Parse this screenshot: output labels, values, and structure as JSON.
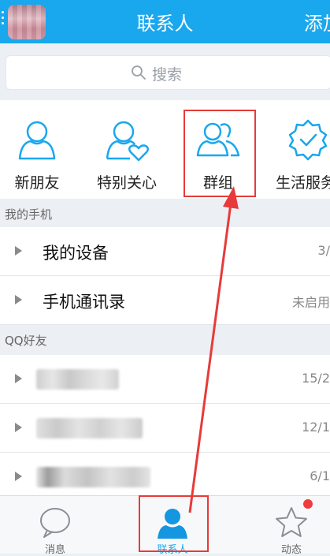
{
  "header": {
    "title": "联系人",
    "add_label": "添加"
  },
  "search": {
    "placeholder": "搜索"
  },
  "shortcuts": [
    {
      "label": "新朋友",
      "icon": "person-icon"
    },
    {
      "label": "特别关心",
      "icon": "person-heart-icon"
    },
    {
      "label": "群组",
      "icon": "group-icon"
    },
    {
      "label": "生活服务",
      "icon": "badge-check-icon"
    }
  ],
  "sections": {
    "my_phone": "我的手机",
    "qq_friends": "QQ好友"
  },
  "device_rows": [
    {
      "name": "我的设备",
      "count": "3/"
    },
    {
      "name": "手机通讯录",
      "count": "未启用"
    }
  ],
  "friend_groups": [
    {
      "count": "15/2"
    },
    {
      "count": "12/1"
    },
    {
      "count": "6/1"
    }
  ],
  "tabs": [
    {
      "label": "消息",
      "icon": "message-bubble-icon"
    },
    {
      "label": "联系人",
      "icon": "contacts-icon",
      "active": true
    },
    {
      "label": "动态",
      "icon": "star-icon"
    }
  ],
  "colors": {
    "accent": "#19a7ee",
    "highlight": "#e83a3a"
  }
}
